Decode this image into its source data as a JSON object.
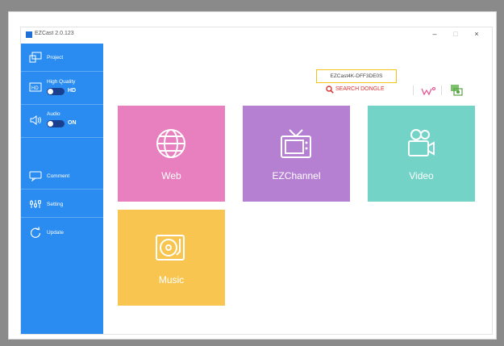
{
  "window": {
    "title": "EZCast 2.0.123"
  },
  "controls": {
    "minimize": "–",
    "maximize": "□",
    "close": "×"
  },
  "sidebar": {
    "items": [
      {
        "label": "Project",
        "icon": "project-icon"
      },
      {
        "label": "High Quality",
        "icon": "quality-icon",
        "toggle_value": "HD"
      },
      {
        "label": "Audio",
        "icon": "audio-icon",
        "toggle_value": "ON"
      },
      {
        "label": "Comment",
        "icon": "comment-icon"
      },
      {
        "label": "Setting",
        "icon": "setting-icon"
      },
      {
        "label": "Update",
        "icon": "update-icon"
      }
    ]
  },
  "device": {
    "name": "EZCast4K-DFF3DE0S"
  },
  "toolbar": {
    "search_label": "SEARCH DONGLE"
  },
  "tiles": [
    {
      "label": "Web",
      "color": "#e87fbe",
      "icon": "globe-icon"
    },
    {
      "label": "EZChannel",
      "color": "#b57fd2",
      "icon": "tv-icon"
    },
    {
      "label": "Video",
      "color": "#73d3c7",
      "icon": "video-camera-icon"
    },
    {
      "label": "Music",
      "color": "#f8c650",
      "icon": "music-player-icon"
    }
  ],
  "colors": {
    "sidebar": "#2a8cf0",
    "highlight_border": "#f2c318",
    "search_red": "#d93333"
  }
}
